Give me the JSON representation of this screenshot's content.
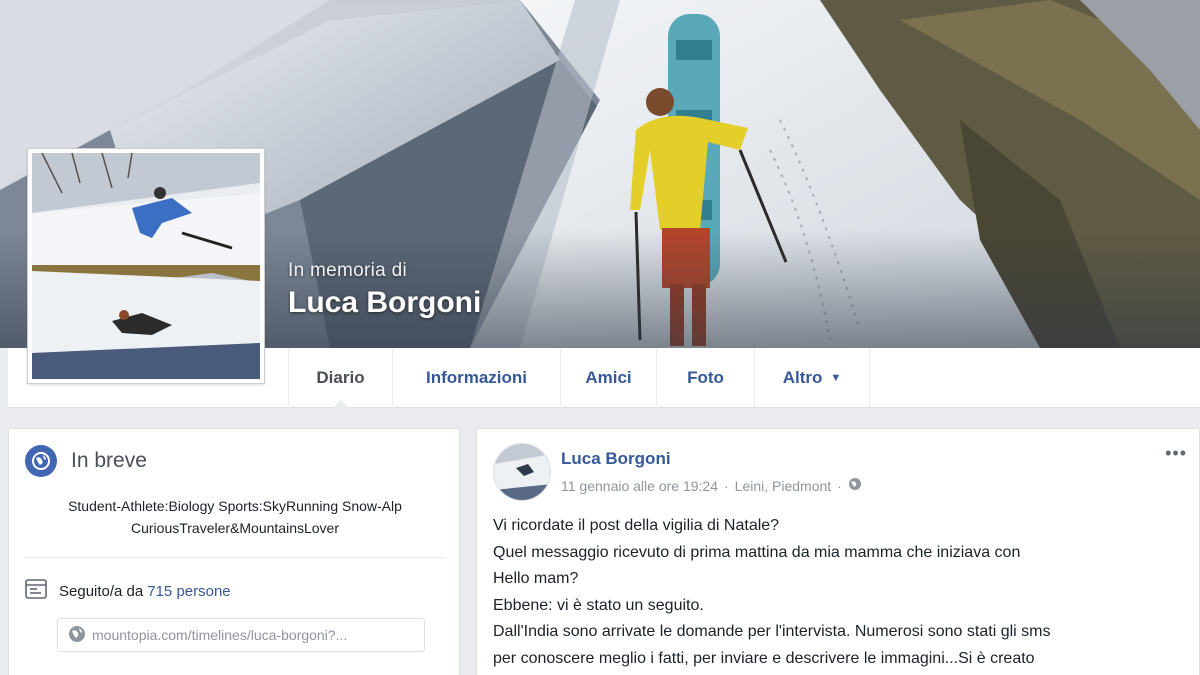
{
  "profile": {
    "memorial_label": "In memoria di",
    "name": "Luca Borgoni"
  },
  "tabs": [
    {
      "label": "Diario"
    },
    {
      "label": "Informazioni"
    },
    {
      "label": "Amici"
    },
    {
      "label": "Foto"
    },
    {
      "label": "Altro"
    }
  ],
  "intro": {
    "title": "In breve",
    "bio": "Student-Athlete:Biology Sports:SkyRunning Snow-Alp CuriousTraveler&MountainsLover",
    "followers_prefix": "Seguito/a da",
    "followers_count": "715 persone",
    "website": "mountopia.com/timelines/luca-borgoni?..."
  },
  "post": {
    "author": "Luca Borgoni",
    "date": "11 gennaio alle ore 19:24",
    "location": "Leini, Piedmont",
    "lines": [
      "Vi ricordate il post della vigilia di Natale?",
      "Quel messaggio ricevuto di prima mattina da mia mamma che iniziava con",
      "Hello mam?",
      "Ebbene: vi è stato un seguito.",
      "Dall'India sono arrivate le domande per l'intervista. Numerosi sono stati gli sms",
      "per conoscere meglio i fatti, per inviare e descrivere le immagini...Si è creato"
    ]
  },
  "colors": {
    "link": "#365899",
    "brand": "#4267b2",
    "page_bg": "#e9ebee"
  },
  "icons": {
    "intro": "globe-icon",
    "followers": "rss-feed-icon",
    "website": "globe-link-icon",
    "post_privacy": "globe-privacy-icon",
    "post_menu": "more-options-icon",
    "tab_more": "caret-down-icon"
  }
}
